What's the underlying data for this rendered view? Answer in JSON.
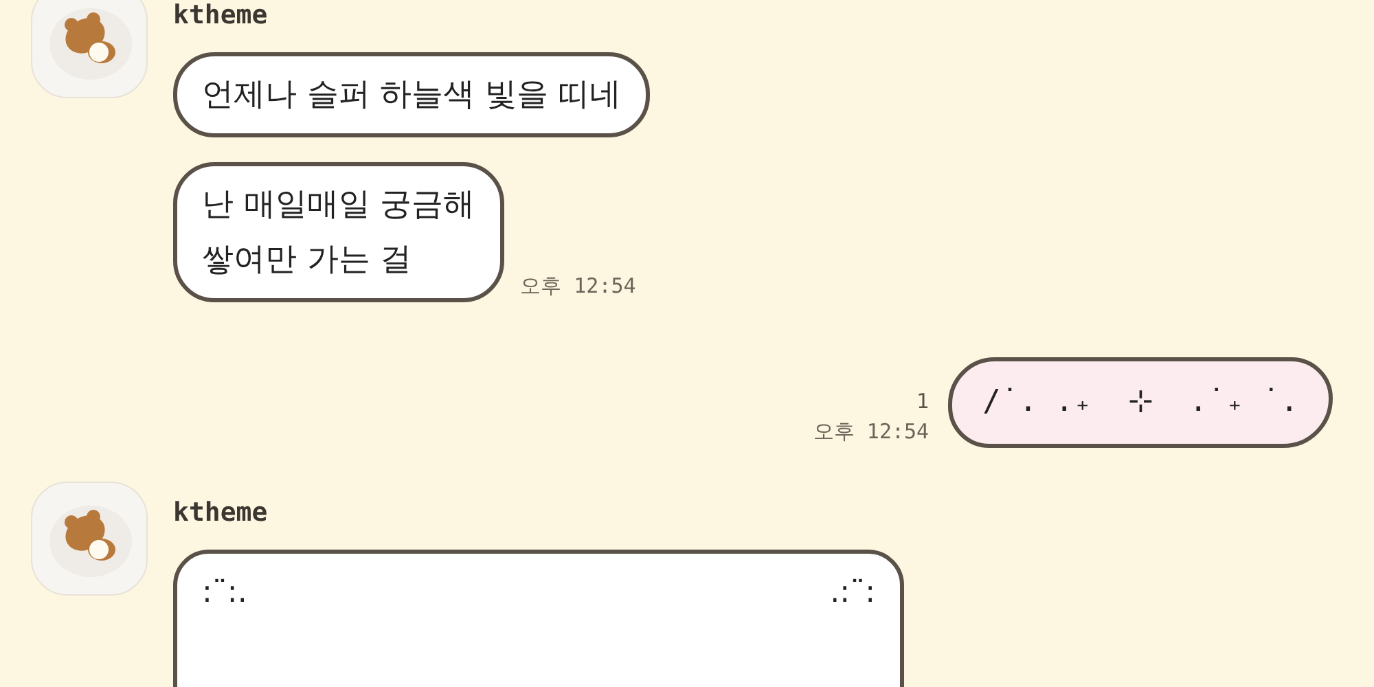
{
  "messages": [
    {
      "kind": "received",
      "sender": "ktheme",
      "bubbles": [
        {
          "kind": "text",
          "text": "언제나 슬퍼 하늘색 빛을 띠네"
        },
        {
          "kind": "text",
          "text": "난 매일매일 궁금해\n쌓여만 가는 걸"
        }
      ],
      "time": "오후 12:54"
    },
    {
      "kind": "sent",
      "unread": "1",
      "time": "오후 12:54",
      "bubbles": [
        {
          "kind": "text",
          "text": "/˙. .₊  ⊹  .˙₊ ˙."
        }
      ]
    },
    {
      "kind": "received",
      "sender": "ktheme",
      "bubbles": [
        {
          "kind": "ornaments",
          "left": ":¨:.",
          "right": ".:¨:"
        }
      ]
    }
  ]
}
